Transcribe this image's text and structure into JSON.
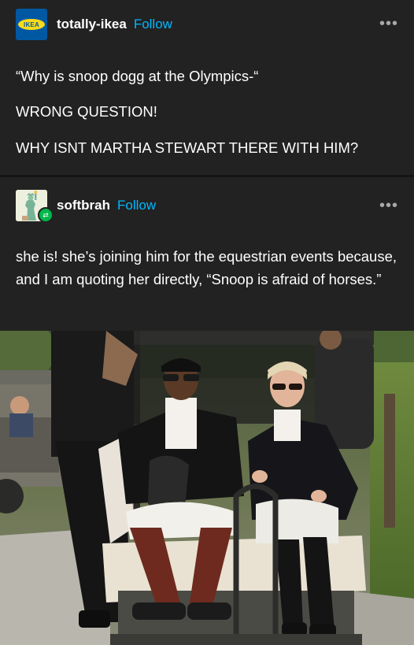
{
  "posts": [
    {
      "username": "totally-ikea",
      "follow_label": "Follow",
      "avatar_text": "IKEA",
      "more_label": "•••",
      "paragraphs": [
        "“Why is snoop dogg at the Olympics-“",
        "WRONG QUESTION!",
        "WHY ISNT MARTHA STEWART THERE WITH HIM?"
      ]
    },
    {
      "username": "softbrah",
      "follow_label": "Follow",
      "more_label": "•••",
      "text": "she is! she’s joining him for the equestrian events because, and I am quoting her directly, “Snoop is afraid of horses.”"
    }
  ],
  "photo": {
    "description_icon": "photo-image"
  },
  "colors": {
    "background": "#222222",
    "follow": "#00b8ff",
    "reblog_badge": "#00b84a",
    "ikea_blue": "#0058a3",
    "ikea_yellow": "#ffda1a"
  }
}
